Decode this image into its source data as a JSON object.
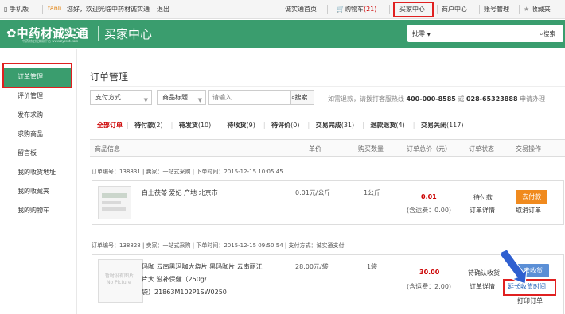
{
  "topbar": {
    "mobile": "手机版",
    "username": "fanli",
    "welcome": "您好，欢迎光临中药材诚实通",
    "logout": "退出",
    "home": "诚实通首页",
    "cart": "购物车",
    "cart_count": "(21)",
    "buyer_center": "买家中心",
    "merchant_center": "商户中心",
    "account_mgmt": "账号管理",
    "favorites": "收藏夹"
  },
  "header": {
    "logo_text": "中药材诚实通",
    "logo_sub": "中药材在线交易平台 www.zycsst.com",
    "title": "买家中心",
    "search_type": "批零",
    "search_button": "搜索"
  },
  "sidebar": {
    "items": [
      {
        "label": "订单管理"
      },
      {
        "label": "评价管理"
      },
      {
        "label": "发布求购"
      },
      {
        "label": "求购商品"
      },
      {
        "label": "留言板"
      },
      {
        "label": "我的收货地址"
      },
      {
        "label": "我的收藏夹"
      },
      {
        "label": "我的购物车"
      }
    ]
  },
  "main": {
    "page_title": "订单管理",
    "filter_payment": "支付方式",
    "filter_title": "商品标题",
    "search_placeholder": "请输入...",
    "search_button": "搜索",
    "hotline_text": "如需退款，请拨打客服热线",
    "hotline1": "400-000-8585",
    "or": "或",
    "hotline2": "028-65323888",
    "apply": "申请办理",
    "tabs": [
      {
        "label": "全部订单",
        "count": ""
      },
      {
        "label": "待付款",
        "count": "(2)"
      },
      {
        "label": "待发货",
        "count": "(10)"
      },
      {
        "label": "待收货",
        "count": "(9)"
      },
      {
        "label": "待评价",
        "count": "(0)"
      },
      {
        "label": "交易完成",
        "count": "(31)"
      },
      {
        "label": "退款退货",
        "count": "(4)"
      },
      {
        "label": "交易关闭",
        "count": "(117)"
      }
    ],
    "columns": [
      "商品信息",
      "单价",
      "购买数量",
      "订单总价（元）",
      "订单状态",
      "交易操作"
    ]
  },
  "orders": [
    {
      "meta": "订单编号：138831 | 卖家：一站式采购 | 下单时间：2015-12-15 10:05:45",
      "product": "白土茯苓 爱妃 产地 北京市",
      "price": "0.01元/公斤",
      "qty": "1公斤",
      "total": "0.01",
      "shipping": "(含运费：0.00)",
      "status": "待付款",
      "detail": "订单详情",
      "action1": "去付款",
      "action2": "取消订单"
    },
    {
      "meta": "订单编号：138828 | 卖家：一站式采购 | 下单时间：2015-12-15 09:50:54 | 支付方式：诚实通支付",
      "product_line1": "玛咖 云南黑玛咖大烧片 黑玛咖片 云南丽江",
      "product_line2": "片大 滋补保健（250g/",
      "product_line3": "袋）21863M102P1SW0250",
      "thumb_text": "暂时没有图片",
      "thumb_sub": "No Picture",
      "price": "28.00元/袋",
      "qty": "1袋",
      "total": "30.00",
      "shipping": "(含运费：2.00)",
      "status": "待确认收货",
      "detail": "订单详情",
      "action1": "去收货",
      "action2": "延长收货时间",
      "action3": "打印订单"
    }
  ]
}
